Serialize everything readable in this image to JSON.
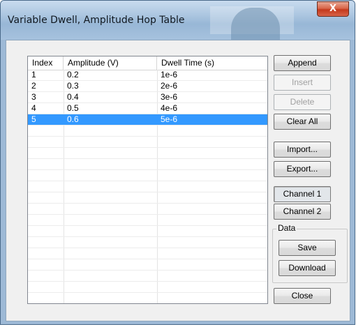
{
  "window": {
    "title": "Variable Dwell, Amplitude Hop Table",
    "close_glyph": "X"
  },
  "table": {
    "columns": [
      "Index",
      "Amplitude (V)",
      "Dwell Time (s)"
    ],
    "rows": [
      [
        "1",
        "0.2",
        "1e-6"
      ],
      [
        "2",
        "0.3",
        "2e-6"
      ],
      [
        "3",
        "0.4",
        "3e-6"
      ],
      [
        "4",
        "0.5",
        "4e-6"
      ],
      [
        "5",
        "0.6",
        "5e-6"
      ]
    ],
    "selected_row": 5
  },
  "buttons": {
    "append": "Append",
    "insert": "Insert",
    "delete": "Delete",
    "clear_all": "Clear All",
    "import": "Import...",
    "export": "Export...",
    "channel1": "Channel 1",
    "channel2": "Channel 2",
    "save": "Save",
    "download": "Download",
    "close": "Close"
  },
  "data_group": {
    "label": "Data"
  }
}
